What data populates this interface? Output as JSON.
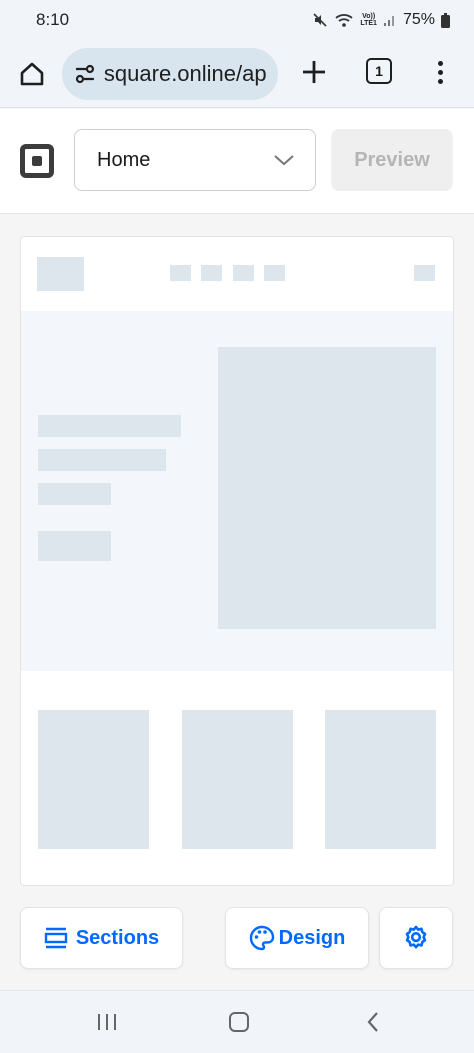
{
  "status_bar": {
    "time": "8:10",
    "volte_top": "Vo))",
    "volte_bottom": "LTE1",
    "battery": "75%",
    "icons": [
      "mute-icon",
      "wifi-icon",
      "signal-icon",
      "battery-icon"
    ]
  },
  "browser": {
    "url": "square.online/ap",
    "tab_count": "1",
    "icons": [
      "home-icon",
      "site-settings-icon",
      "plus-icon",
      "tabs-icon",
      "more-icon"
    ]
  },
  "header": {
    "page_select_value": "Home",
    "preview_label": "Preview"
  },
  "toolbar": {
    "sections_label": "Sections",
    "design_label": "Design"
  },
  "colors": {
    "accent": "#006aff",
    "placeholder": "#dde5ed",
    "hero_bg": "#f3f7fb"
  }
}
